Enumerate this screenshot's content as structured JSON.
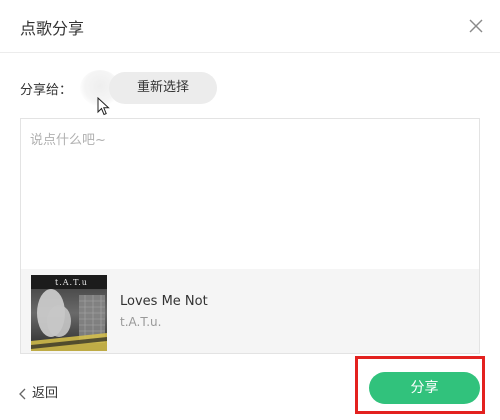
{
  "dialog": {
    "title": "点歌分享"
  },
  "share_to": {
    "label": "分享给：",
    "reselect_label": "重新选择"
  },
  "compose": {
    "placeholder": "说点什么吧~"
  },
  "song": {
    "name": "Loves Me Not",
    "artist": "t.A.T.u.",
    "album_art_text": "t.A.T.u"
  },
  "footer": {
    "back_label": "返回",
    "share_label": "分享"
  },
  "colors": {
    "accent": "#31c27c",
    "highlight": "#e3211f"
  },
  "icons": {
    "close": "close-icon",
    "back": "chevron-left-icon",
    "cursor": "mouse-cursor-icon"
  }
}
